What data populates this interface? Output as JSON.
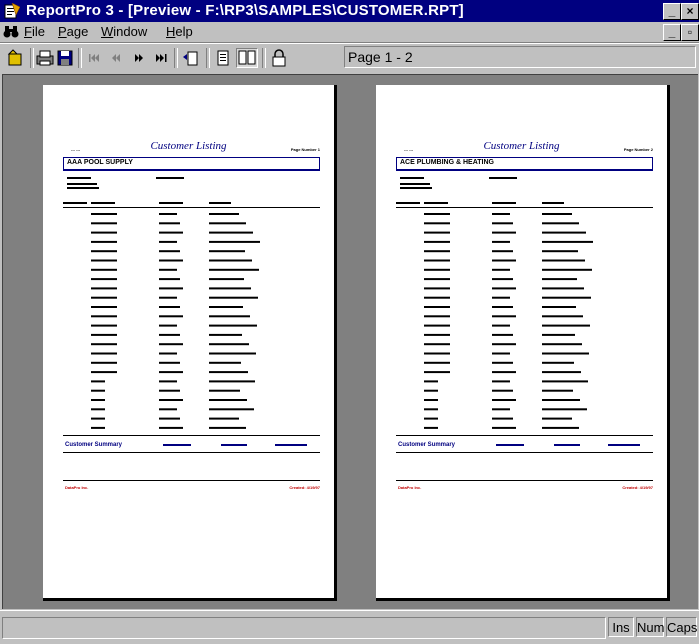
{
  "window": {
    "title": "ReportPro 3 - [Preview - F:\\RP3\\SAMPLES\\CUSTOMER.RPT]",
    "controls": {
      "minimize": "_",
      "maximize": "□",
      "close": "X",
      "restore": "▫"
    }
  },
  "menu": {
    "items": [
      "File",
      "Page",
      "Window",
      "Help"
    ],
    "accel": [
      "F",
      "P",
      "W",
      "H"
    ],
    "rest": [
      "ile",
      "age",
      "indow",
      "elp"
    ]
  },
  "toolbar": {
    "page_indicator": "Page 1 - 2"
  },
  "pages": [
    {
      "title": "Customer Listing",
      "left_header": "--- ---",
      "right_header": "Page Number 1",
      "customer_name": "AAA POOL SUPPLY",
      "summary_label": "Customer Summary",
      "footer_left": "DataPro Inc.",
      "footer_right": "Created: 4/19/97"
    },
    {
      "title": "Customer Listing",
      "left_header": "--- ---",
      "right_header": "Page Number 2",
      "customer_name": "ACE PLUMBING & HEATING",
      "summary_label": "Customer Summary",
      "footer_left": "DataPro Inc.",
      "footer_right": "Created: 4/19/97"
    }
  ],
  "status": {
    "ins": "Ins",
    "num": "Num",
    "caps": "Caps"
  },
  "colors": {
    "titlebar": "#000080",
    "report_accent": "#000080",
    "footer_red": "#c00000"
  }
}
